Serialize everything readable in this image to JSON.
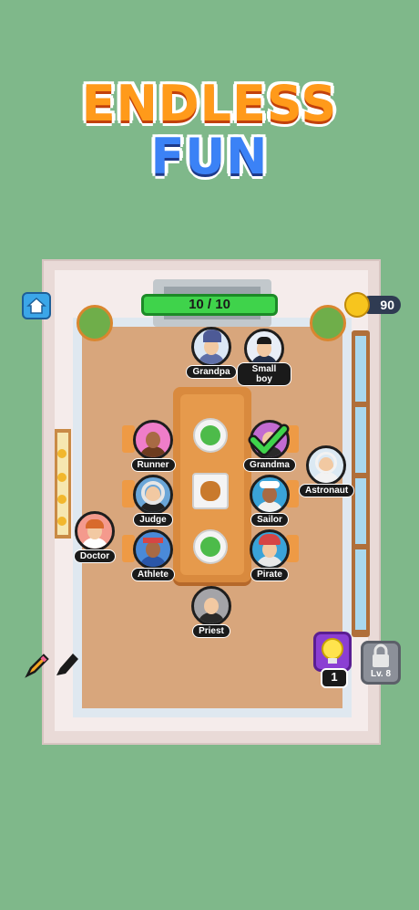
{
  "title": {
    "line1": "ENDLESS",
    "line2": "FUN"
  },
  "progress": {
    "text": "10 / 10",
    "fraction": 1.0
  },
  "coins": {
    "value": "90"
  },
  "hint": {
    "count": "1"
  },
  "lock": {
    "label": "Lv. 8"
  },
  "people": [
    {
      "name": "Grandpa"
    },
    {
      "name": "Small boy"
    },
    {
      "name": "Runner"
    },
    {
      "name": "Grandma"
    },
    {
      "name": "Astronaut"
    },
    {
      "name": "Judge"
    },
    {
      "name": "Sailor"
    },
    {
      "name": "Doctor"
    },
    {
      "name": "Athlete"
    },
    {
      "name": "Pirate"
    },
    {
      "name": "Priest"
    }
  ],
  "icons": [
    "home-icon",
    "coin-icon",
    "checkmark-icon",
    "lightbulb-icon",
    "lock-icon",
    "pencil-icon",
    "marker-icon"
  ],
  "colors": {
    "background": "#7fb88a",
    "progress_fill": "#3fd34b",
    "title_orange": "#ff9a1a",
    "title_blue": "#3b82f6",
    "hint_purple": "#8b3fd3"
  }
}
